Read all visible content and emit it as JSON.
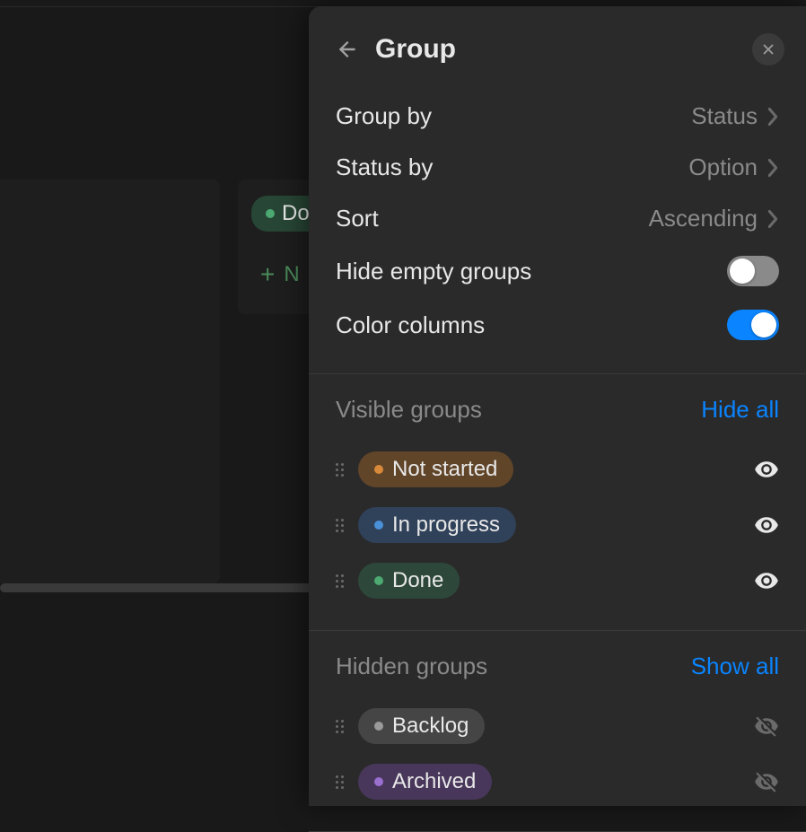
{
  "background": {
    "done_pill_label": "Do",
    "new_label": "N"
  },
  "panel": {
    "title": "Group",
    "settings": {
      "group_by": {
        "label": "Group by",
        "value": "Status"
      },
      "status_by": {
        "label": "Status by",
        "value": "Option"
      },
      "sort": {
        "label": "Sort",
        "value": "Ascending"
      },
      "hide_empty": {
        "label": "Hide empty groups",
        "enabled": false
      },
      "color_columns": {
        "label": "Color columns",
        "enabled": true
      }
    },
    "visible_groups": {
      "title": "Visible groups",
      "action": "Hide all",
      "items": [
        {
          "label": "Not started",
          "color": "orange"
        },
        {
          "label": "In progress",
          "color": "blue"
        },
        {
          "label": "Done",
          "color": "green"
        }
      ]
    },
    "hidden_groups": {
      "title": "Hidden groups",
      "action": "Show all",
      "items": [
        {
          "label": "Backlog",
          "color": "gray"
        },
        {
          "label": "Archived",
          "color": "purple"
        }
      ]
    }
  }
}
